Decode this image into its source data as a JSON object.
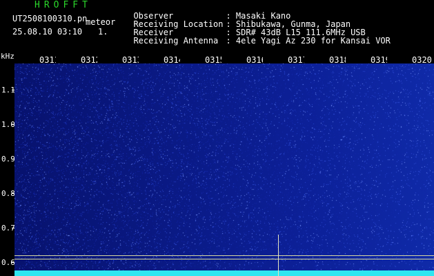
{
  "header": {
    "app_title": "HROFFT",
    "file_name": "UT2508100310.pn",
    "mode": "meteor",
    "date": "25.08.10 03:10",
    "count": "1."
  },
  "info": [
    {
      "label": "Observer",
      "value": ": Masaki Kano"
    },
    {
      "label": "Receiving Location",
      "value": ": Shibukawa, Gunma, Japan"
    },
    {
      "label": "Receiver",
      "value": ": SDR# 43dB L15 111.6MHz USB"
    },
    {
      "label": "Receiving Antenna",
      "value": ": 4ele Yagi Az 230 for Kansai VOR"
    }
  ],
  "y_axis": {
    "unit": "kHz",
    "ticks": [
      "1.1",
      "1.0",
      "0.9",
      "0.8",
      "0.7",
      "0.6"
    ]
  },
  "x_axis": {
    "ticks": [
      "0311",
      "0312",
      "0313",
      "0314",
      "0315",
      "0316",
      "0317",
      "0318",
      "0319",
      "0320"
    ]
  },
  "colors": {
    "title": "#2bd82b",
    "background": "#000000",
    "spectrogram": "#0a1a86",
    "baseline": "#2fe6f0"
  }
}
